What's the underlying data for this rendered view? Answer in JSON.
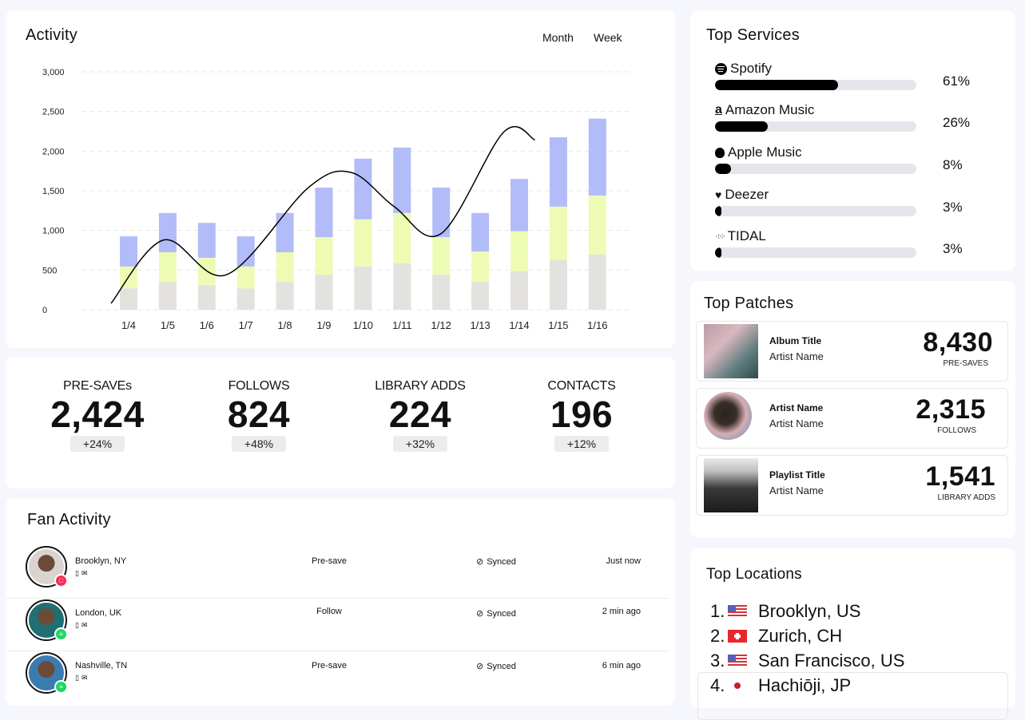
{
  "activity": {
    "title": "Activity",
    "toggles": [
      "Month",
      "Week"
    ]
  },
  "chart_data": {
    "type": "bar",
    "stacked": true,
    "title": "Activity",
    "xlabel": "",
    "ylabel": "",
    "ylim": [
      0,
      3000
    ],
    "yticks": [
      "0",
      "500",
      "1,000",
      "1,500",
      "2,000",
      "2,500",
      "3,000"
    ],
    "ytick_values": [
      0,
      500,
      1000,
      1500,
      2000,
      2500,
      3000
    ],
    "grid": true,
    "categories": [
      "1/4",
      "1/5",
      "1/6",
      "1/7",
      "1/8",
      "1/9",
      "1/10",
      "1/11",
      "1/12",
      "1/13",
      "1/14",
      "1/15",
      "1/16"
    ],
    "series": [
      {
        "name": "base",
        "color": "#e3e2df",
        "values": [
          270,
          350,
          310,
          270,
          350,
          440,
          545,
          585,
          440,
          350,
          485,
          625,
          695
        ]
      },
      {
        "name": "middle",
        "color": "#eefbb4",
        "values": [
          275,
          375,
          345,
          275,
          375,
          475,
          595,
          635,
          475,
          385,
          505,
          675,
          745
        ]
      },
      {
        "name": "top",
        "color": "#b2bcf8",
        "values": [
          380,
          495,
          440,
          380,
          495,
          625,
          765,
          825,
          625,
          485,
          660,
          875,
          970
        ]
      }
    ],
    "trend_line": {
      "name": "trend",
      "color": "#000000",
      "points": [
        [
          -0.45,
          80
        ],
        [
          0.9,
          880
        ],
        [
          2.5,
          440
        ],
        [
          4.6,
          1540
        ],
        [
          5.7,
          1730
        ],
        [
          6.8,
          1300
        ],
        [
          8.0,
          960
        ],
        [
          9.6,
          2240
        ],
        [
          10.4,
          2140
        ]
      ]
    }
  },
  "stats": [
    {
      "label": "PRE-SAVEs",
      "value": "2,424",
      "change": "+24%"
    },
    {
      "label": "FOLLOWS",
      "value": "824",
      "change": "+48%"
    },
    {
      "label": "LIBRARY ADDS",
      "value": "224",
      "change": "+32%"
    },
    {
      "label": "CONTACTS",
      "value": "196",
      "change": "+12%"
    }
  ],
  "fan_activity": {
    "title": "Fan Activity",
    "rows": [
      {
        "location": "Brooklyn, NY",
        "action": "Pre-save",
        "status": "Synced",
        "time": "Just now",
        "service": "apple-music",
        "badge_color": "#fa2d55",
        "avatar_color": "#d9d4cf"
      },
      {
        "location": "London, UK",
        "action": "Follow",
        "status": "Synced",
        "time": "2 min ago",
        "service": "spotify",
        "badge_color": "#1ed760",
        "avatar_color": "#1f6f73"
      },
      {
        "location": "Nashville, TN",
        "action": "Pre-save",
        "status": "Synced",
        "time": "6 min ago",
        "service": "spotify",
        "badge_color": "#1ed760",
        "avatar_color": "#3a7bb0"
      }
    ]
  },
  "top_services": {
    "title": "Top Services",
    "items": [
      {
        "name": "Spotify",
        "icon": "spotify-icon",
        "percent": 61,
        "label": "61%"
      },
      {
        "name": "Amazon Music",
        "icon": "amazon-icon",
        "percent": 26,
        "label": "26%"
      },
      {
        "name": "Apple Music",
        "icon": "apple-icon",
        "percent": 8,
        "label": "8%"
      },
      {
        "name": "Deezer",
        "icon": "deezer-icon",
        "percent": 3,
        "label": "3%"
      },
      {
        "name": "TIDAL",
        "icon": "tidal-icon",
        "percent": 3,
        "label": "3%"
      }
    ]
  },
  "top_patches": {
    "title": "Top Patches",
    "items": [
      {
        "title": "Album Title",
        "subtitle": "Artist Name",
        "value": "8,430",
        "unit": "PRE-SAVES",
        "kind": "album"
      },
      {
        "title": "Artist Name",
        "subtitle": "Artist Name",
        "value": "2,315",
        "unit": "FOLLOWS",
        "kind": "artist"
      },
      {
        "title": "Playlist Title",
        "subtitle": "Artist Name",
        "value": "1,541",
        "unit": "LIBRARY ADDS",
        "kind": "playlist"
      }
    ]
  },
  "top_locations": {
    "title": "Top Locations",
    "items": [
      {
        "rank": "1.",
        "flag": "us-flag",
        "name": "Brooklyn, US"
      },
      {
        "rank": "2.",
        "flag": "ch-flag",
        "name": "Zurich, CH"
      },
      {
        "rank": "3.",
        "flag": "us-flag",
        "name": "San Francisco, US"
      },
      {
        "rank": "4.",
        "flag": "jp-flag",
        "name": "Hachiōji, JP"
      }
    ]
  }
}
